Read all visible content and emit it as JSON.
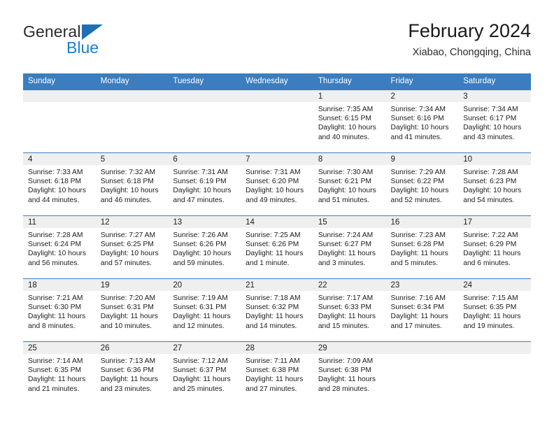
{
  "brand": {
    "line1": "General",
    "line2": "Blue",
    "triangle_color": "#1f6fb5",
    "blue_color": "#1b7fd4"
  },
  "header": {
    "title": "February 2024",
    "subtitle": "Xiabao, Chongqing, China"
  },
  "theme": {
    "header_bg": "#3b7dbf",
    "header_text": "#ffffff",
    "daynum_band_bg": "#efefef",
    "row_border": "#3b7dbf"
  },
  "calendar": {
    "weekday_headers": [
      "Sunday",
      "Monday",
      "Tuesday",
      "Wednesday",
      "Thursday",
      "Friday",
      "Saturday"
    ],
    "labels": {
      "sunrise": "Sunrise:",
      "sunset": "Sunset:",
      "daylight": "Daylight:"
    },
    "weeks": [
      [
        {
          "day": "",
          "sunrise": "",
          "sunset": "",
          "daylight": "",
          "empty": true
        },
        {
          "day": "",
          "sunrise": "",
          "sunset": "",
          "daylight": "",
          "empty": true
        },
        {
          "day": "",
          "sunrise": "",
          "sunset": "",
          "daylight": "",
          "empty": true
        },
        {
          "day": "",
          "sunrise": "",
          "sunset": "",
          "daylight": "",
          "empty": true
        },
        {
          "day": "1",
          "sunrise": "Sunrise: 7:35 AM",
          "sunset": "Sunset: 6:15 PM",
          "daylight": "Daylight: 10 hours and 40 minutes.",
          "empty": false
        },
        {
          "day": "2",
          "sunrise": "Sunrise: 7:34 AM",
          "sunset": "Sunset: 6:16 PM",
          "daylight": "Daylight: 10 hours and 41 minutes.",
          "empty": false
        },
        {
          "day": "3",
          "sunrise": "Sunrise: 7:34 AM",
          "sunset": "Sunset: 6:17 PM",
          "daylight": "Daylight: 10 hours and 43 minutes.",
          "empty": false
        }
      ],
      [
        {
          "day": "4",
          "sunrise": "Sunrise: 7:33 AM",
          "sunset": "Sunset: 6:18 PM",
          "daylight": "Daylight: 10 hours and 44 minutes.",
          "empty": false
        },
        {
          "day": "5",
          "sunrise": "Sunrise: 7:32 AM",
          "sunset": "Sunset: 6:18 PM",
          "daylight": "Daylight: 10 hours and 46 minutes.",
          "empty": false
        },
        {
          "day": "6",
          "sunrise": "Sunrise: 7:31 AM",
          "sunset": "Sunset: 6:19 PM",
          "daylight": "Daylight: 10 hours and 47 minutes.",
          "empty": false
        },
        {
          "day": "7",
          "sunrise": "Sunrise: 7:31 AM",
          "sunset": "Sunset: 6:20 PM",
          "daylight": "Daylight: 10 hours and 49 minutes.",
          "empty": false
        },
        {
          "day": "8",
          "sunrise": "Sunrise: 7:30 AM",
          "sunset": "Sunset: 6:21 PM",
          "daylight": "Daylight: 10 hours and 51 minutes.",
          "empty": false
        },
        {
          "day": "9",
          "sunrise": "Sunrise: 7:29 AM",
          "sunset": "Sunset: 6:22 PM",
          "daylight": "Daylight: 10 hours and 52 minutes.",
          "empty": false
        },
        {
          "day": "10",
          "sunrise": "Sunrise: 7:28 AM",
          "sunset": "Sunset: 6:23 PM",
          "daylight": "Daylight: 10 hours and 54 minutes.",
          "empty": false
        }
      ],
      [
        {
          "day": "11",
          "sunrise": "Sunrise: 7:28 AM",
          "sunset": "Sunset: 6:24 PM",
          "daylight": "Daylight: 10 hours and 56 minutes.",
          "empty": false
        },
        {
          "day": "12",
          "sunrise": "Sunrise: 7:27 AM",
          "sunset": "Sunset: 6:25 PM",
          "daylight": "Daylight: 10 hours and 57 minutes.",
          "empty": false
        },
        {
          "day": "13",
          "sunrise": "Sunrise: 7:26 AM",
          "sunset": "Sunset: 6:26 PM",
          "daylight": "Daylight: 10 hours and 59 minutes.",
          "empty": false
        },
        {
          "day": "14",
          "sunrise": "Sunrise: 7:25 AM",
          "sunset": "Sunset: 6:26 PM",
          "daylight": "Daylight: 11 hours and 1 minute.",
          "empty": false
        },
        {
          "day": "15",
          "sunrise": "Sunrise: 7:24 AM",
          "sunset": "Sunset: 6:27 PM",
          "daylight": "Daylight: 11 hours and 3 minutes.",
          "empty": false
        },
        {
          "day": "16",
          "sunrise": "Sunrise: 7:23 AM",
          "sunset": "Sunset: 6:28 PM",
          "daylight": "Daylight: 11 hours and 5 minutes.",
          "empty": false
        },
        {
          "day": "17",
          "sunrise": "Sunrise: 7:22 AM",
          "sunset": "Sunset: 6:29 PM",
          "daylight": "Daylight: 11 hours and 6 minutes.",
          "empty": false
        }
      ],
      [
        {
          "day": "18",
          "sunrise": "Sunrise: 7:21 AM",
          "sunset": "Sunset: 6:30 PM",
          "daylight": "Daylight: 11 hours and 8 minutes.",
          "empty": false
        },
        {
          "day": "19",
          "sunrise": "Sunrise: 7:20 AM",
          "sunset": "Sunset: 6:31 PM",
          "daylight": "Daylight: 11 hours and 10 minutes.",
          "empty": false
        },
        {
          "day": "20",
          "sunrise": "Sunrise: 7:19 AM",
          "sunset": "Sunset: 6:31 PM",
          "daylight": "Daylight: 11 hours and 12 minutes.",
          "empty": false
        },
        {
          "day": "21",
          "sunrise": "Sunrise: 7:18 AM",
          "sunset": "Sunset: 6:32 PM",
          "daylight": "Daylight: 11 hours and 14 minutes.",
          "empty": false
        },
        {
          "day": "22",
          "sunrise": "Sunrise: 7:17 AM",
          "sunset": "Sunset: 6:33 PM",
          "daylight": "Daylight: 11 hours and 15 minutes.",
          "empty": false
        },
        {
          "day": "23",
          "sunrise": "Sunrise: 7:16 AM",
          "sunset": "Sunset: 6:34 PM",
          "daylight": "Daylight: 11 hours and 17 minutes.",
          "empty": false
        },
        {
          "day": "24",
          "sunrise": "Sunrise: 7:15 AM",
          "sunset": "Sunset: 6:35 PM",
          "daylight": "Daylight: 11 hours and 19 minutes.",
          "empty": false
        }
      ],
      [
        {
          "day": "25",
          "sunrise": "Sunrise: 7:14 AM",
          "sunset": "Sunset: 6:35 PM",
          "daylight": "Daylight: 11 hours and 21 minutes.",
          "empty": false
        },
        {
          "day": "26",
          "sunrise": "Sunrise: 7:13 AM",
          "sunset": "Sunset: 6:36 PM",
          "daylight": "Daylight: 11 hours and 23 minutes.",
          "empty": false
        },
        {
          "day": "27",
          "sunrise": "Sunrise: 7:12 AM",
          "sunset": "Sunset: 6:37 PM",
          "daylight": "Daylight: 11 hours and 25 minutes.",
          "empty": false
        },
        {
          "day": "28",
          "sunrise": "Sunrise: 7:11 AM",
          "sunset": "Sunset: 6:38 PM",
          "daylight": "Daylight: 11 hours and 27 minutes.",
          "empty": false
        },
        {
          "day": "29",
          "sunrise": "Sunrise: 7:09 AM",
          "sunset": "Sunset: 6:38 PM",
          "daylight": "Daylight: 11 hours and 28 minutes.",
          "empty": false
        },
        {
          "day": "",
          "sunrise": "",
          "sunset": "",
          "daylight": "",
          "empty": true
        },
        {
          "day": "",
          "sunrise": "",
          "sunset": "",
          "daylight": "",
          "empty": true
        }
      ]
    ]
  }
}
